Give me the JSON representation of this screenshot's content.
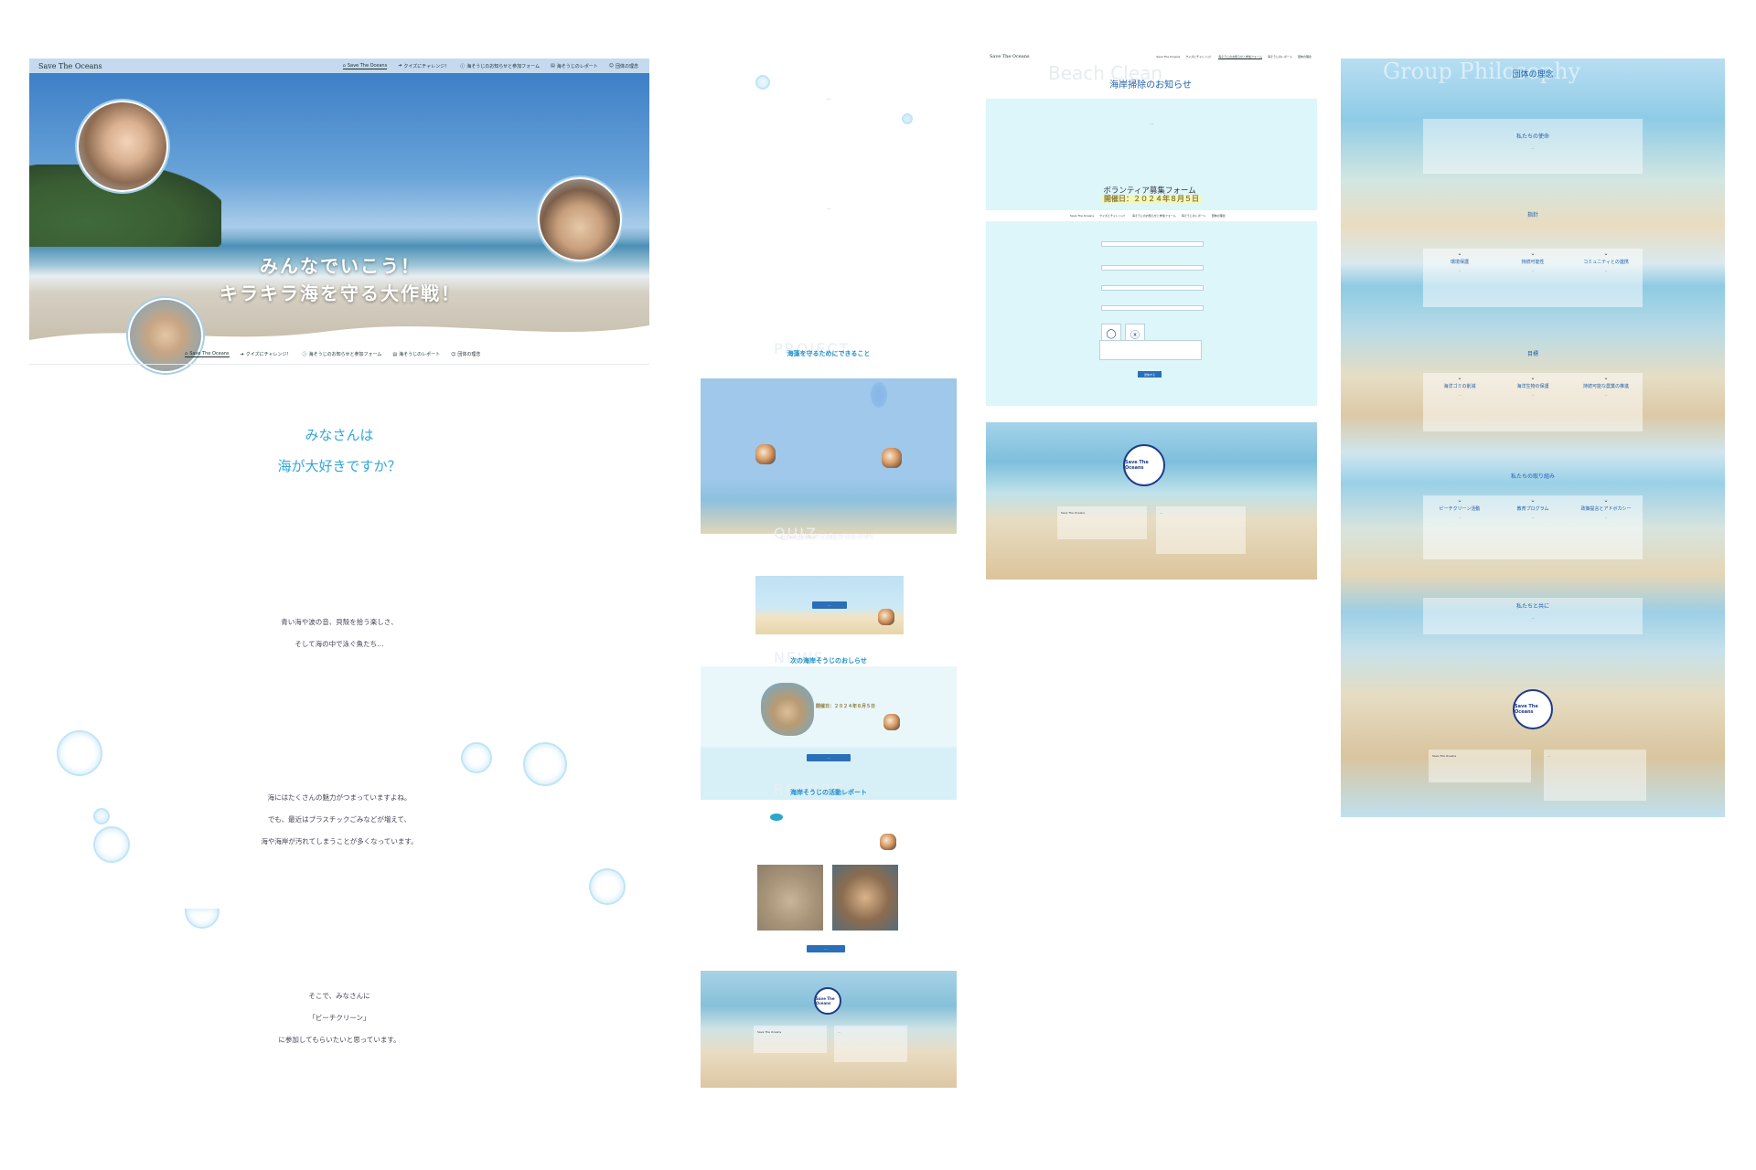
{
  "panel1": {
    "brand": "Save The Oceans",
    "nav": [
      {
        "icon": "home-icon",
        "label": "Save The Oceans"
      },
      {
        "icon": "arrow-icon",
        "label": "クイズにチャレンジ！"
      },
      {
        "icon": "info-icon",
        "label": "海そうじのお知らせと参加フォーム"
      },
      {
        "icon": "doc-icon",
        "label": "海そうじのレポート"
      },
      {
        "icon": "people-icon",
        "label": "団体の理念"
      }
    ],
    "hero_catch_1": "みんなでいこう！",
    "hero_catch_2": "キラキラ海を守る大作戦！",
    "question_1": "みなさんは",
    "question_2": "海が大好きですか？",
    "para1": [
      "青い海や波の音、貝殻を拾う楽しさ、",
      "そして海の中で泳ぐ魚たち…"
    ],
    "para2": [
      "海にはたくさんの魅力がつまっていますよね。",
      "でも、最近はプラスチックごみなどが増えて、",
      "海や海岸が汚れてしまうことが多くなっています。"
    ],
    "para3": [
      "そこで、みなさんに",
      "「ビーチクリーン」",
      "に参加してもらいたいと思っています。"
    ]
  },
  "panel2": {
    "project_ghost": "PROJECT",
    "project_title": "海藻を守るためにできること",
    "quiz_ghost": "QUIZ",
    "quiz_title": "海と海岸のクイズにチャレンジ！",
    "news_ghost": "NEWS",
    "news_title": "次の海岸そうじのおしらせ",
    "news_date": "開催日：２０２４年８月５日",
    "report_ghost": "REPORT",
    "report_title": "海岸そうじの活動レポート",
    "footer_logo": "Save The Oceans"
  },
  "panel3": {
    "brand": "Save The Oceans",
    "ghost": "Beach Clean",
    "title": "海岸掃除のお知らせ",
    "date": "開催日：２０２４年８月５日",
    "form_title": "ボランティア募集フォーム",
    "submit": "送信する",
    "footer_logo": "Save The Oceans"
  },
  "panel4": {
    "ghost": "Group Philosophy",
    "title": "団体の理念",
    "mission_title": "私たちの使命",
    "policy_title": "指針",
    "policy": [
      "環境保護",
      "持続可能性",
      "コミュニティとの連携"
    ],
    "goal_title": "目標",
    "goals": [
      "海洋ゴミの削減",
      "海洋生物の保護",
      "持続可能な農業の推進"
    ],
    "effort_title": "私たちの取り組み",
    "efforts": [
      "ビーチクリーン活動",
      "教育プログラム",
      "政策提言とアドボカシー"
    ],
    "together_title": "私たちと共に",
    "footer_logo": "Save The Oceans"
  }
}
